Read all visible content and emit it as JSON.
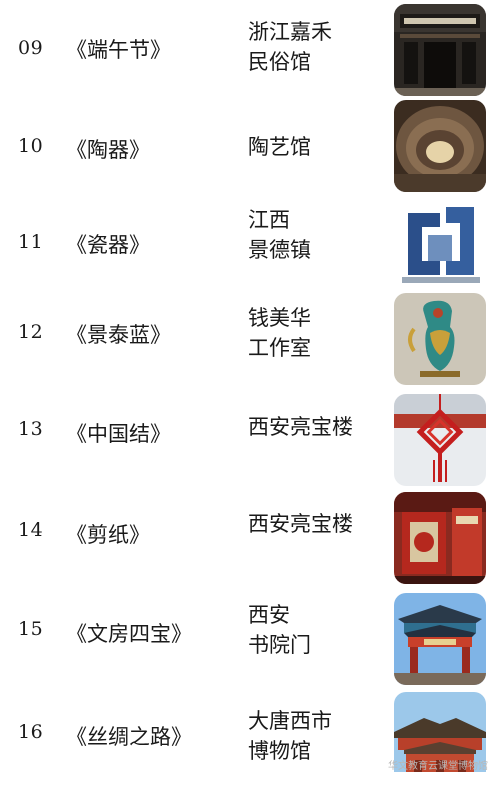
{
  "rows": [
    {
      "num": "09",
      "title": "《端午节》",
      "place": [
        "浙江嘉禾",
        "民俗馆"
      ],
      "icon": "museum-gate-photo"
    },
    {
      "num": "10",
      "title": "《陶器》",
      "place": [
        "陶艺馆"
      ],
      "icon": "kiln-tunnel-photo"
    },
    {
      "num": "11",
      "title": "《瓷器》",
      "place": [
        "江西",
        "景德镇"
      ],
      "icon": "porcelain-sculpture-photo"
    },
    {
      "num": "12",
      "title": "《景泰蓝》",
      "place": [
        "钱美华",
        "工作室"
      ],
      "icon": "cloisonne-vessel-photo"
    },
    {
      "num": "13",
      "title": "《中国结》",
      "place": [
        "西安亮宝楼"
      ],
      "icon": "chinese-knot-photo"
    },
    {
      "num": "14",
      "title": "《剪纸》",
      "place": [
        "西安亮宝楼"
      ],
      "icon": "paper-cut-exhibit-photo"
    },
    {
      "num": "15",
      "title": "《文房四宝》",
      "place": [
        "西安",
        "书院门"
      ],
      "icon": "shuyuanmen-gate-photo"
    },
    {
      "num": "16",
      "title": "《丝绸之路》",
      "place": [
        "大唐西市",
        "博物馆"
      ],
      "icon": "tang-market-building-photo"
    }
  ],
  "watermark": "华文教育云课堂博物馆"
}
